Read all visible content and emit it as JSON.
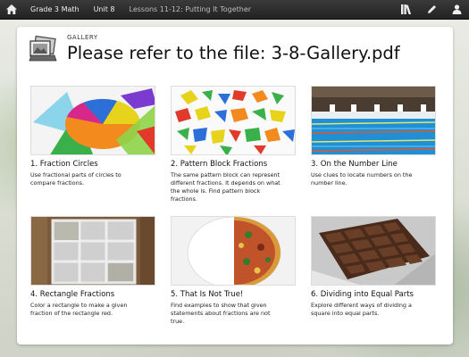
{
  "nav": {
    "home_icon": "home-icon",
    "course": "Grade 3 Math",
    "unit": "Unit 8",
    "lesson": "Lessons 11-12: Putting It Together",
    "tools": [
      "library-icon",
      "pencil-icon",
      "person-icon"
    ]
  },
  "header": {
    "section_label": "GALLERY",
    "title": "Please refer to the file:  3-8-Gallery.pdf"
  },
  "tiles": [
    {
      "title": "1. Fraction Circles",
      "desc": "Use fractional parts of circles to compare fractions."
    },
    {
      "title": "2. Pattern Block Fractions",
      "desc": "The same pattern block can represent different fractions. It depends on what the whole is. Find pattern block fractions."
    },
    {
      "title": "3. On the Number Line",
      "desc": "Use clues to locate numbers on the number line."
    },
    {
      "title": "4. Rectangle Fractions",
      "desc": "Color a rectangle to make a given fraction of the rectangle red."
    },
    {
      "title": "5. That Is Not True!",
      "desc": "Find examples to show that given statements about fractions are not true."
    },
    {
      "title": "6. Dividing into Equal Parts",
      "desc": "Explore different ways of dividing a square into equal parts."
    }
  ]
}
